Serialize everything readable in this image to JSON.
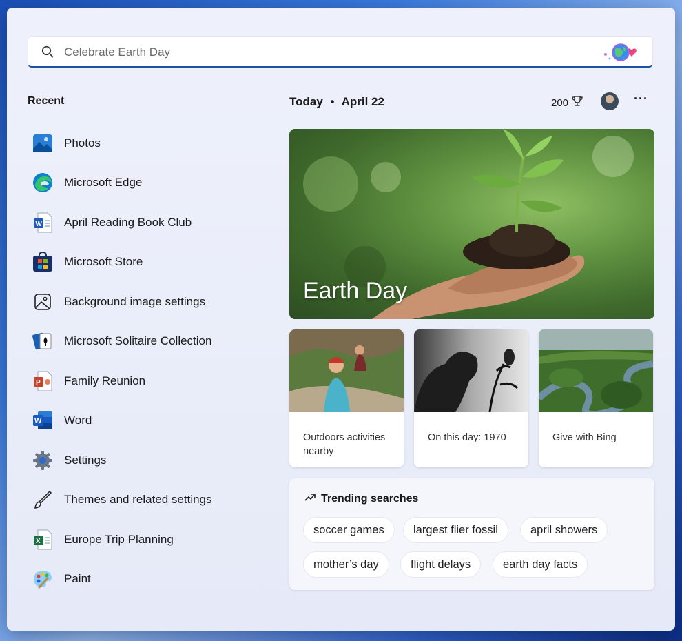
{
  "search": {
    "placeholder": "Celebrate Earth Day"
  },
  "recent": {
    "title": "Recent",
    "items": [
      {
        "label": "Photos",
        "icon": "photos-icon"
      },
      {
        "label": "Microsoft Edge",
        "icon": "edge-icon"
      },
      {
        "label": "April Reading Book Club",
        "icon": "word-doc-icon"
      },
      {
        "label": "Microsoft Store",
        "icon": "store-icon"
      },
      {
        "label": "Background image settings",
        "icon": "image-settings-icon"
      },
      {
        "label": "Microsoft Solitaire Collection",
        "icon": "solitaire-icon"
      },
      {
        "label": "Family Reunion",
        "icon": "powerpoint-icon"
      },
      {
        "label": "Word",
        "icon": "word-icon"
      },
      {
        "label": "Settings",
        "icon": "gear-icon"
      },
      {
        "label": "Themes and related settings",
        "icon": "brush-icon"
      },
      {
        "label": "Europe Trip Planning",
        "icon": "excel-icon"
      },
      {
        "label": "Paint",
        "icon": "paint-icon"
      }
    ]
  },
  "today": {
    "label": "Today",
    "separator": "•",
    "date": "April 22",
    "points": "200"
  },
  "hero": {
    "title": "Earth Day"
  },
  "cards": [
    {
      "label": "Outdoors activities nearby"
    },
    {
      "label": "On this day: 1970"
    },
    {
      "label": "Give with Bing"
    }
  ],
  "trending": {
    "title": "Trending searches",
    "chips": [
      "soccer games",
      "largest flier fossil",
      "april showers",
      "mother’s day",
      "flight delays",
      "earth day facts"
    ]
  }
}
